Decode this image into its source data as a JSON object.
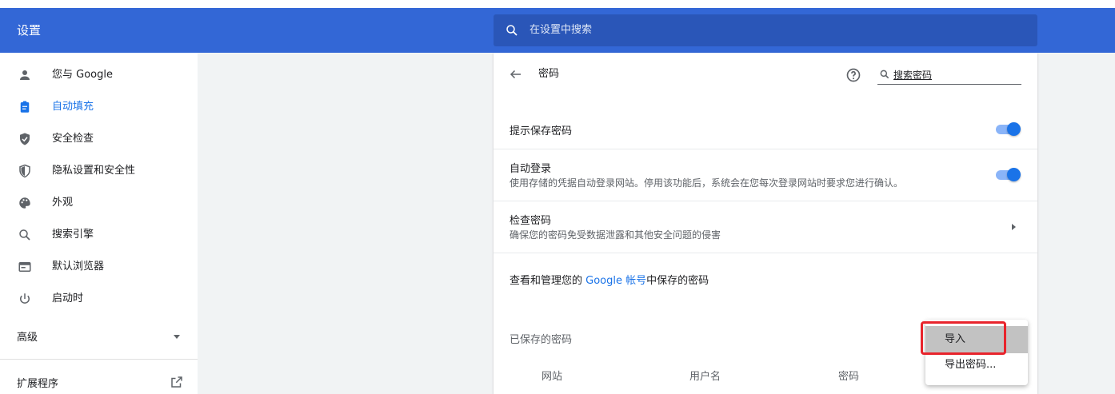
{
  "header": {
    "title": "设置",
    "search_placeholder": "在设置中搜索"
  },
  "sidebar": {
    "items": [
      {
        "label": "您与 Google",
        "icon": "person-icon"
      },
      {
        "label": "自动填充",
        "icon": "clipboard-icon",
        "active": true
      },
      {
        "label": "安全检查",
        "icon": "shield-check-icon"
      },
      {
        "label": "隐私设置和安全性",
        "icon": "shield-half-icon"
      },
      {
        "label": "外观",
        "icon": "palette-icon"
      },
      {
        "label": "搜索引擎",
        "icon": "search-icon"
      },
      {
        "label": "默认浏览器",
        "icon": "browser-window-icon"
      },
      {
        "label": "启动时",
        "icon": "power-icon"
      }
    ],
    "advanced": "高级",
    "extensions": "扩展程序"
  },
  "passwords": {
    "title": "密码",
    "search_label": "搜索密码",
    "offer_to_save": "提示保存密码",
    "auto_signin_title": "自动登录",
    "auto_signin_desc": "使用存储的凭据自动登录网站。停用该功能后，系统会在您每次登录网站时要求您进行确认。",
    "check_title": "检查密码",
    "check_desc": "确保您的密码免受数据泄露和其他安全问题的侵害",
    "manage_prefix": "查看和管理您的 ",
    "manage_link": "Google 帐号",
    "manage_suffix": "中保存的密码",
    "saved_heading": "已保存的密码",
    "columns": [
      "网站",
      "用户名",
      "密码"
    ]
  },
  "menu": {
    "import": "导入",
    "export": "导出密码..."
  },
  "colors": {
    "header": "#3367d6",
    "accent": "#1a73e8",
    "highlight_border": "#e8242c"
  }
}
